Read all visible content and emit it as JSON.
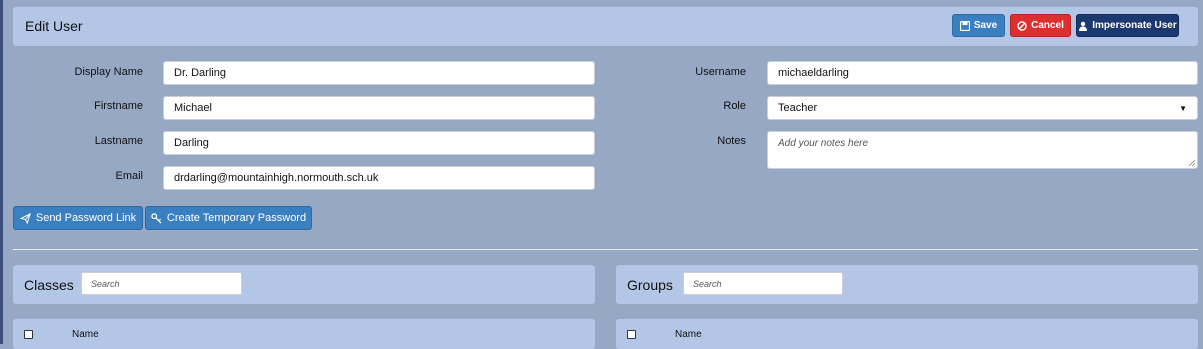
{
  "header": {
    "title": "Edit User",
    "save_label": "Save",
    "cancel_label": "Cancel",
    "impersonate_label": "Impersonate User"
  },
  "form": {
    "display_name": {
      "label": "Display Name",
      "value": "Dr. Darling"
    },
    "firstname": {
      "label": "Firstname",
      "value": "Michael"
    },
    "lastname": {
      "label": "Lastname",
      "value": "Darling"
    },
    "email": {
      "label": "Email",
      "value": "drdarling@mountainhigh.normouth.sch.uk"
    },
    "username": {
      "label": "Username",
      "value": "michaeldarling"
    },
    "role": {
      "label": "Role",
      "value": "Teacher"
    },
    "notes": {
      "label": "Notes",
      "placeholder": "Add your notes here"
    }
  },
  "actions": {
    "send_link": "Send Password Link",
    "temp_password": "Create Temporary Password"
  },
  "classes": {
    "title": "Classes",
    "search_placeholder": "Search",
    "column_name": "Name"
  },
  "groups": {
    "title": "Groups",
    "search_placeholder": "Search",
    "column_name": "Name"
  },
  "colors": {
    "save": "#3a7fc0",
    "cancel": "#dc2f2f",
    "impersonate": "#1c3870",
    "background": "#96a8c3",
    "panel": "#b4c6e6"
  }
}
